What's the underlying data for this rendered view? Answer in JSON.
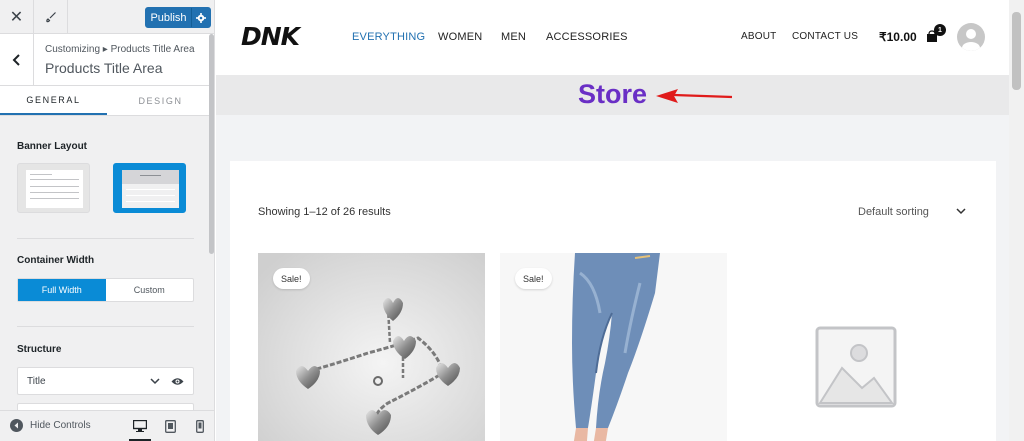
{
  "customizer": {
    "close_icon": "close-icon",
    "publish_label": "Publish",
    "breadcrumb": "Customizing ▸ Products Title Area",
    "section_title": "Products Title Area",
    "tabs": [
      {
        "label": "GENERAL",
        "active": true
      },
      {
        "label": "DESIGN",
        "active": false
      }
    ],
    "banner_layout": {
      "label": "Banner Layout",
      "options": [
        "layout-1",
        "layout-2"
      ],
      "selected": "layout-2"
    },
    "container_width": {
      "label": "Container Width",
      "options": [
        {
          "label": "Full Width",
          "active": true
        },
        {
          "label": "Custom",
          "active": false
        }
      ]
    },
    "structure": {
      "label": "Structure",
      "items": [
        "Title"
      ]
    },
    "footer": {
      "hide_controls": "Hide Controls",
      "devices": [
        "desktop",
        "tablet",
        "mobile"
      ],
      "active_device": "desktop"
    },
    "accent_color": "#2271b1"
  },
  "site": {
    "logo": "DNK",
    "nav": [
      {
        "label": "EVERYTHING",
        "active": true
      },
      {
        "label": "WOMEN",
        "active": false
      },
      {
        "label": "MEN",
        "active": false
      },
      {
        "label": "ACCESSORIES",
        "active": false
      }
    ],
    "secondary_nav": [
      "ABOUT",
      "CONTACT US"
    ],
    "cart_total": "₹10.00",
    "cart_count": "1",
    "page_title": "Store",
    "title_color": "#6a2fc5",
    "result_count": "Showing 1–12 of 26 results",
    "sorting": "Default sorting",
    "products": [
      {
        "badge": "Sale!",
        "image": "bracelet"
      },
      {
        "badge": "Sale!",
        "image": "jeans"
      },
      {
        "badge": "",
        "image": "placeholder"
      }
    ]
  }
}
